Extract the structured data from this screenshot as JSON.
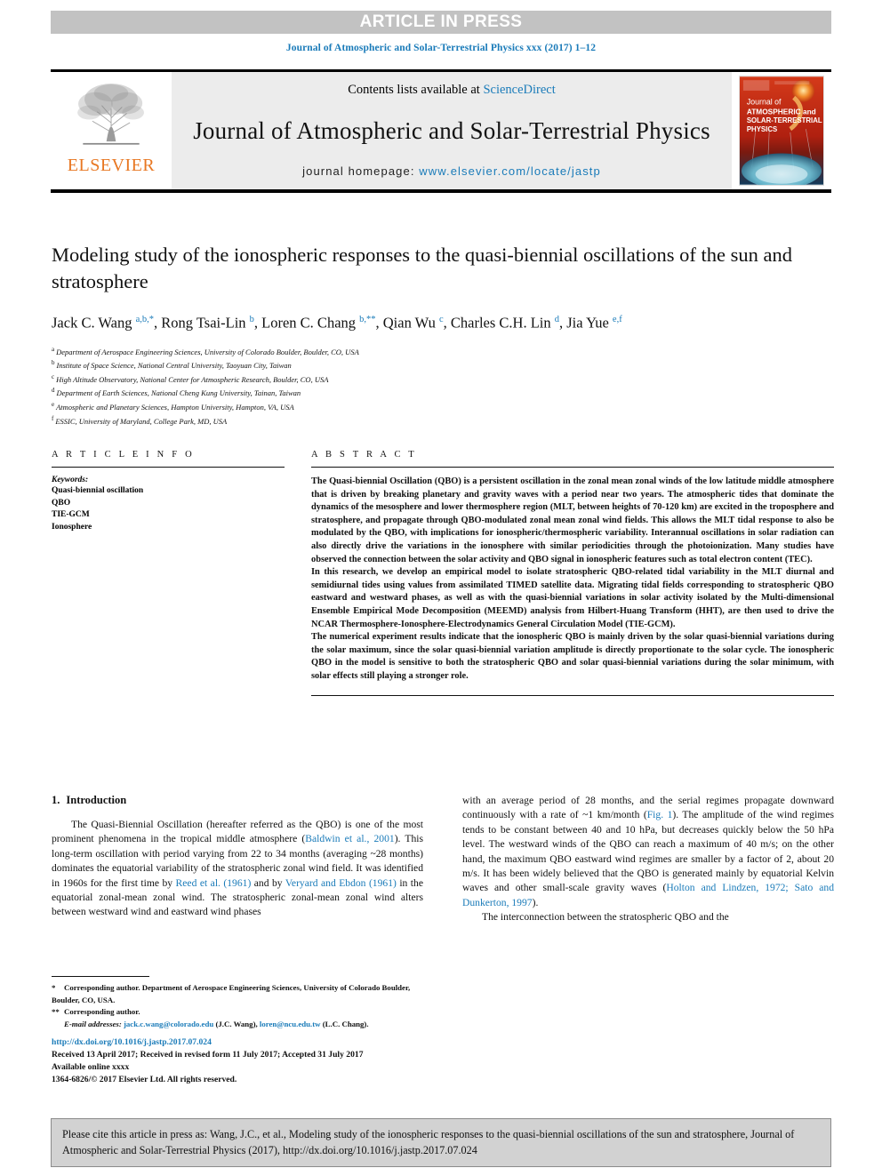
{
  "banner": {
    "text": "ARTICLE IN PRESS"
  },
  "running_head": "Journal of Atmospheric and Solar-Terrestrial Physics xxx (2017) 1–12",
  "masthead": {
    "publisher_name": "ELSEVIER",
    "contents_prefix": "Contents lists available at ",
    "contents_link": "ScienceDirect",
    "journal_title": "Journal of Atmospheric and Solar-Terrestrial Physics",
    "homepage_label": "journal homepage: ",
    "homepage_url": "www.elsevier.com/locate/jastp",
    "cover_title_line1": "Journal of",
    "cover_title_line2": "ATMOSPHERIC and",
    "cover_title_line3": "SOLAR-TERRESTRIAL",
    "cover_title_line4": "PHYSICS"
  },
  "article": {
    "title": "Modeling study of the ionospheric responses to the quasi-biennial oscillations of the sun and stratosphere",
    "authors_html": "Jack C. Wang <sup>a,b,*</sup>, Rong Tsai-Lin <sup>b</sup>, Loren C. Chang <sup>b,**</sup>, Qian Wu <sup>c</sup>, Charles C.H. Lin <sup>d</sup>, Jia Yue <sup>e,f</sup>",
    "affiliations": [
      {
        "mark": "a",
        "text": "Department of Aerospace Engineering Sciences, University of Colorado Boulder, Boulder, CO, USA"
      },
      {
        "mark": "b",
        "text": "Institute of Space Science, National Central University, Taoyuan City, Taiwan"
      },
      {
        "mark": "c",
        "text": "High Altitude Observatory, National Center for Atmospheric Research, Boulder, CO, USA"
      },
      {
        "mark": "d",
        "text": "Department of Earth Sciences, National Cheng Kung University, Tainan, Taiwan"
      },
      {
        "mark": "e",
        "text": "Atmospheric and Planetary Sciences, Hampton University, Hampton, VA, USA"
      },
      {
        "mark": "f",
        "text": "ESSIC, University of Maryland, College Park, MD, USA"
      }
    ]
  },
  "article_info": {
    "heading": "A R T I C L E   I N F O",
    "keywords_label": "Keywords:",
    "keywords": [
      "Quasi-biennial oscillation",
      "QBO",
      "TIE-GCM",
      "Ionosphere"
    ]
  },
  "abstract": {
    "heading": "A B S T R A C T",
    "paragraphs": [
      "The Quasi-biennial Oscillation (QBO) is a persistent oscillation in the zonal mean zonal winds of the low latitude middle atmosphere that is driven by breaking planetary and gravity waves with a period near two years. The atmospheric tides that dominate the dynamics of the mesosphere and lower thermosphere region (MLT, between heights of 70-120 km) are excited in the troposphere and stratosphere, and propagate through QBO-modulated zonal mean zonal wind fields. This allows the MLT tidal response to also be modulated by the QBO, with implications for ionospheric/thermospheric variability. Interannual oscillations in solar radiation can also directly drive the variations in the ionosphere with similar periodicities through the photoionization. Many studies have observed the connection between the solar activity and QBO signal in ionospheric features such as total electron content (TEC).",
      "In this research, we develop an empirical model to isolate stratospheric QBO-related tidal variability in the MLT diurnal and semidiurnal tides using values from assimilated TIMED satellite data. Migrating tidal fields corresponding to stratospheric QBO eastward and westward phases, as well as with the quasi-biennial variations in solar activity isolated by the Multi-dimensional Ensemble Empirical Mode Decomposition (MEEMD) analysis from Hilbert-Huang Transform (HHT), are then used to drive the NCAR Thermosphere-Ionosphere-Electrodynamics General Circulation Model (TIE-GCM).",
      "The numerical experiment results indicate that the ionospheric QBO is mainly driven by the solar quasi-biennial variations during the solar maximum, since the solar quasi-biennial variation amplitude is directly proportionate to the solar cycle. The ionospheric QBO in the model is sensitive to both the stratospheric QBO and solar quasi-biennial variations during the solar minimum, with solar effects still playing a stronger role."
    ]
  },
  "body": {
    "section_number": "1.",
    "section_title": "Introduction",
    "left_paragraph_html": "The Quasi-Biennial Oscillation (hereafter referred as the QBO) is one of the most prominent phenomena in the tropical middle atmosphere (<span class=\"ref\">Baldwin et al., 2001</span>). This long-term oscillation with period varying from 22 to 34 months (averaging ~28 months) dominates the equatorial variability of the stratospheric zonal wind field. It was identified in 1960s for the first time by <span class=\"ref\">Reed et al. (1961)</span> and by <span class=\"ref\">Veryard and Ebdon (1961)</span> in the equatorial zonal-mean zonal wind. The stratospheric zonal-mean zonal wind alters between westward wind and eastward wind phases",
    "right_paragraph_html": "with an average period of 28 months, and the serial regimes propagate downward continuously with a rate of ~1 km/month (<span class=\"ref\">Fig. 1</span>). The amplitude of the wind regimes tends to be constant between 40 and 10 hPa, but decreases quickly below the 50 hPa level. The westward winds of the QBO can reach a maximum of 40 m/s; on the other hand, the maximum QBO eastward wind regimes are smaller by a factor of 2, about 20 m/s. It has been widely believed that the QBO is generated mainly by equatorial Kelvin waves and other small-scale gravity waves (<span class=\"ref\">Holton and Lindzen, 1972; Sato and Dunkerton, 1997</span>).",
    "right_paragraph2_html": "The interconnection between the stratospheric QBO and the"
  },
  "footnotes": {
    "star_mark": "*",
    "star_text": "Corresponding author. Department of Aerospace Engineering Sciences, University of Colorado Boulder, Boulder, CO, USA.",
    "dstar_mark": "**",
    "dstar_text": "Corresponding author.",
    "email_label": "E-mail addresses:",
    "email1": "jack.c.wang@colorado.edu",
    "email1_owner": "(J.C. Wang),",
    "email2": "loren@ncu.edu.tw",
    "email2_owner": "(L.C. Chang)."
  },
  "publication": {
    "doi_url": "http://dx.doi.org/10.1016/j.jastp.2017.07.024",
    "received_line": "Received 13 April 2017; Received in revised form 11 July 2017; Accepted 31 July 2017",
    "available_line": "Available online xxxx",
    "copyright_line": "1364-6826/© 2017 Elsevier Ltd. All rights reserved."
  },
  "citation_box": {
    "text": "Please cite this article in press as: Wang, J.C., et al., Modeling study of the ionospheric responses to the quasi-biennial oscillations of the sun and stratosphere, Journal of Atmospheric and Solar-Terrestrial Physics (2017), http://dx.doi.org/10.1016/j.jastp.2017.07.024"
  },
  "colors": {
    "link": "#1a7bb9",
    "banner_bg": "#c2c2c2",
    "masthead_bg": "#ececec",
    "elsevier_orange": "#e87722",
    "cite_bg": "#d2d2d2"
  }
}
